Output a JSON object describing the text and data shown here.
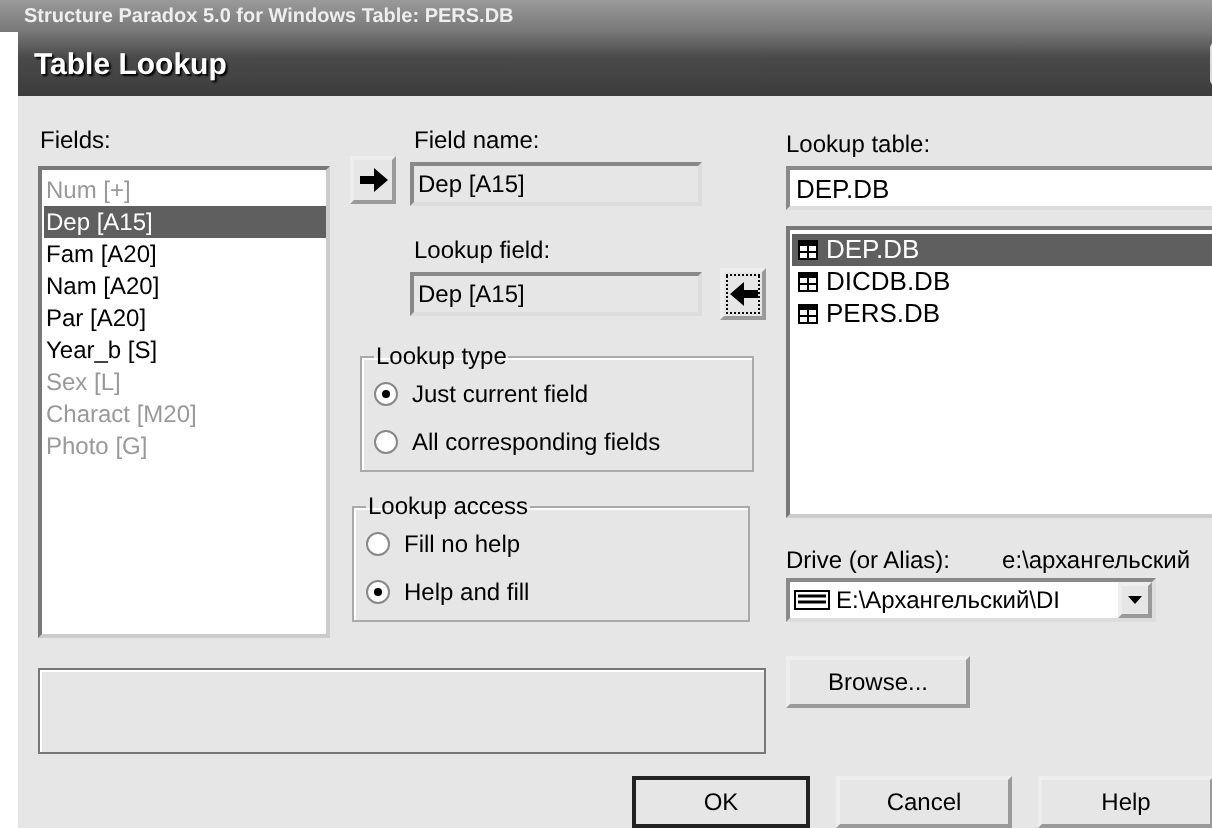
{
  "parent_window": {
    "title": "Structure Paradox 5.0 for Windows Table: PERS.DB"
  },
  "dialog": {
    "title": "Table Lookup"
  },
  "fields": {
    "label": "Fields:",
    "items": [
      {
        "text": "Num [+]",
        "disabled": true,
        "selected": false
      },
      {
        "text": "Dep [A15]",
        "disabled": false,
        "selected": true
      },
      {
        "text": "Fam [A20]",
        "disabled": false,
        "selected": false
      },
      {
        "text": "Nam [A20]",
        "disabled": false,
        "selected": false
      },
      {
        "text": "Par [A20]",
        "disabled": false,
        "selected": false
      },
      {
        "text": "Year_b [S]",
        "disabled": false,
        "selected": false
      },
      {
        "text": "Sex [L]",
        "disabled": true,
        "selected": false
      },
      {
        "text": "Charact [M20]",
        "disabled": true,
        "selected": false
      },
      {
        "text": "Photo [G]",
        "disabled": true,
        "selected": false
      }
    ]
  },
  "field_name": {
    "label": "Field name:",
    "value": "Dep [A15]"
  },
  "lookup_field": {
    "label": "Lookup field:",
    "value": "Dep [A15]"
  },
  "lookup_type": {
    "label": "Lookup type",
    "options": [
      {
        "label": "Just current field",
        "selected": true
      },
      {
        "label": "All corresponding fields",
        "selected": false
      }
    ]
  },
  "lookup_access": {
    "label": "Lookup access",
    "options": [
      {
        "label": "Fill no help",
        "selected": false
      },
      {
        "label": "Help and fill",
        "selected": true
      }
    ]
  },
  "lookup_table": {
    "label": "Lookup table:",
    "value": "DEP.DB",
    "items": [
      {
        "text": "DEP.DB",
        "selected": true
      },
      {
        "text": "DICDB.DB",
        "selected": false
      },
      {
        "text": "PERS.DB",
        "selected": false
      }
    ]
  },
  "drive": {
    "label": "Drive (or Alias):",
    "path": "e:\\архангельский",
    "value": "E:\\Архангельский\\DI"
  },
  "browse_button": "Browse...",
  "buttons": [
    {
      "label": "OK",
      "default": true
    },
    {
      "label": "Cancel",
      "default": false
    },
    {
      "label": "Help",
      "default": false
    }
  ]
}
